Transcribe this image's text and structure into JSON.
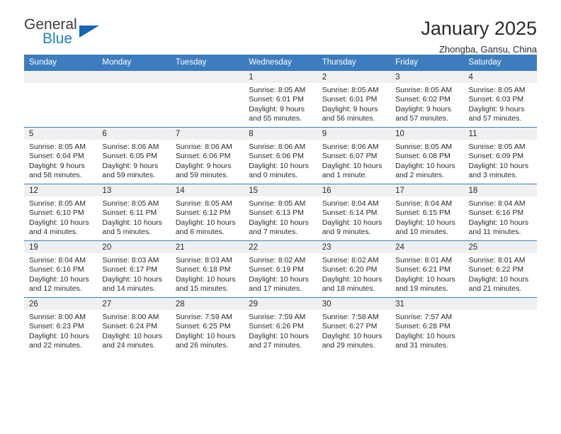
{
  "brand": {
    "name_top": "General",
    "name_bottom": "Blue",
    "triangle_color": "#1668b3",
    "blue_color": "#1f7fc4"
  },
  "header": {
    "title": "January 2025",
    "subtitle": "Zhongba, Gansu, China"
  },
  "theme": {
    "header_bg": "#3d7dbf",
    "header_text": "#ffffff",
    "daynum_band_bg": "#f0f0f0",
    "row_rule": "#3d7dbf",
    "body_text": "#2b2b2b"
  },
  "weekday_headers": [
    "Sunday",
    "Monday",
    "Tuesday",
    "Wednesday",
    "Thursday",
    "Friday",
    "Saturday"
  ],
  "weeks": [
    [
      {
        "day": "",
        "sunrise": "",
        "sunset": "",
        "daylight": ""
      },
      {
        "day": "",
        "sunrise": "",
        "sunset": "",
        "daylight": ""
      },
      {
        "day": "",
        "sunrise": "",
        "sunset": "",
        "daylight": ""
      },
      {
        "day": "1",
        "sunrise": "Sunrise: 8:05 AM",
        "sunset": "Sunset: 6:01 PM",
        "daylight": "Daylight: 9 hours and 55 minutes."
      },
      {
        "day": "2",
        "sunrise": "Sunrise: 8:05 AM",
        "sunset": "Sunset: 6:01 PM",
        "daylight": "Daylight: 9 hours and 56 minutes."
      },
      {
        "day": "3",
        "sunrise": "Sunrise: 8:05 AM",
        "sunset": "Sunset: 6:02 PM",
        "daylight": "Daylight: 9 hours and 57 minutes."
      },
      {
        "day": "4",
        "sunrise": "Sunrise: 8:05 AM",
        "sunset": "Sunset: 6:03 PM",
        "daylight": "Daylight: 9 hours and 57 minutes."
      }
    ],
    [
      {
        "day": "5",
        "sunrise": "Sunrise: 8:05 AM",
        "sunset": "Sunset: 6:04 PM",
        "daylight": "Daylight: 9 hours and 58 minutes."
      },
      {
        "day": "6",
        "sunrise": "Sunrise: 8:06 AM",
        "sunset": "Sunset: 6:05 PM",
        "daylight": "Daylight: 9 hours and 59 minutes."
      },
      {
        "day": "7",
        "sunrise": "Sunrise: 8:06 AM",
        "sunset": "Sunset: 6:06 PM",
        "daylight": "Daylight: 9 hours and 59 minutes."
      },
      {
        "day": "8",
        "sunrise": "Sunrise: 8:06 AM",
        "sunset": "Sunset: 6:06 PM",
        "daylight": "Daylight: 10 hours and 0 minutes."
      },
      {
        "day": "9",
        "sunrise": "Sunrise: 8:06 AM",
        "sunset": "Sunset: 6:07 PM",
        "daylight": "Daylight: 10 hours and 1 minute."
      },
      {
        "day": "10",
        "sunrise": "Sunrise: 8:05 AM",
        "sunset": "Sunset: 6:08 PM",
        "daylight": "Daylight: 10 hours and 2 minutes."
      },
      {
        "day": "11",
        "sunrise": "Sunrise: 8:05 AM",
        "sunset": "Sunset: 6:09 PM",
        "daylight": "Daylight: 10 hours and 3 minutes."
      }
    ],
    [
      {
        "day": "12",
        "sunrise": "Sunrise: 8:05 AM",
        "sunset": "Sunset: 6:10 PM",
        "daylight": "Daylight: 10 hours and 4 minutes."
      },
      {
        "day": "13",
        "sunrise": "Sunrise: 8:05 AM",
        "sunset": "Sunset: 6:11 PM",
        "daylight": "Daylight: 10 hours and 5 minutes."
      },
      {
        "day": "14",
        "sunrise": "Sunrise: 8:05 AM",
        "sunset": "Sunset: 6:12 PM",
        "daylight": "Daylight: 10 hours and 6 minutes."
      },
      {
        "day": "15",
        "sunrise": "Sunrise: 8:05 AM",
        "sunset": "Sunset: 6:13 PM",
        "daylight": "Daylight: 10 hours and 7 minutes."
      },
      {
        "day": "16",
        "sunrise": "Sunrise: 8:04 AM",
        "sunset": "Sunset: 6:14 PM",
        "daylight": "Daylight: 10 hours and 9 minutes."
      },
      {
        "day": "17",
        "sunrise": "Sunrise: 8:04 AM",
        "sunset": "Sunset: 6:15 PM",
        "daylight": "Daylight: 10 hours and 10 minutes."
      },
      {
        "day": "18",
        "sunrise": "Sunrise: 8:04 AM",
        "sunset": "Sunset: 6:16 PM",
        "daylight": "Daylight: 10 hours and 11 minutes."
      }
    ],
    [
      {
        "day": "19",
        "sunrise": "Sunrise: 8:04 AM",
        "sunset": "Sunset: 6:16 PM",
        "daylight": "Daylight: 10 hours and 12 minutes."
      },
      {
        "day": "20",
        "sunrise": "Sunrise: 8:03 AM",
        "sunset": "Sunset: 6:17 PM",
        "daylight": "Daylight: 10 hours and 14 minutes."
      },
      {
        "day": "21",
        "sunrise": "Sunrise: 8:03 AM",
        "sunset": "Sunset: 6:18 PM",
        "daylight": "Daylight: 10 hours and 15 minutes."
      },
      {
        "day": "22",
        "sunrise": "Sunrise: 8:02 AM",
        "sunset": "Sunset: 6:19 PM",
        "daylight": "Daylight: 10 hours and 17 minutes."
      },
      {
        "day": "23",
        "sunrise": "Sunrise: 8:02 AM",
        "sunset": "Sunset: 6:20 PM",
        "daylight": "Daylight: 10 hours and 18 minutes."
      },
      {
        "day": "24",
        "sunrise": "Sunrise: 8:01 AM",
        "sunset": "Sunset: 6:21 PM",
        "daylight": "Daylight: 10 hours and 19 minutes."
      },
      {
        "day": "25",
        "sunrise": "Sunrise: 8:01 AM",
        "sunset": "Sunset: 6:22 PM",
        "daylight": "Daylight: 10 hours and 21 minutes."
      }
    ],
    [
      {
        "day": "26",
        "sunrise": "Sunrise: 8:00 AM",
        "sunset": "Sunset: 6:23 PM",
        "daylight": "Daylight: 10 hours and 22 minutes."
      },
      {
        "day": "27",
        "sunrise": "Sunrise: 8:00 AM",
        "sunset": "Sunset: 6:24 PM",
        "daylight": "Daylight: 10 hours and 24 minutes."
      },
      {
        "day": "28",
        "sunrise": "Sunrise: 7:59 AM",
        "sunset": "Sunset: 6:25 PM",
        "daylight": "Daylight: 10 hours and 26 minutes."
      },
      {
        "day": "29",
        "sunrise": "Sunrise: 7:59 AM",
        "sunset": "Sunset: 6:26 PM",
        "daylight": "Daylight: 10 hours and 27 minutes."
      },
      {
        "day": "30",
        "sunrise": "Sunrise: 7:58 AM",
        "sunset": "Sunset: 6:27 PM",
        "daylight": "Daylight: 10 hours and 29 minutes."
      },
      {
        "day": "31",
        "sunrise": "Sunrise: 7:57 AM",
        "sunset": "Sunset: 6:28 PM",
        "daylight": "Daylight: 10 hours and 31 minutes."
      },
      {
        "day": "",
        "sunrise": "",
        "sunset": "",
        "daylight": ""
      }
    ]
  ]
}
